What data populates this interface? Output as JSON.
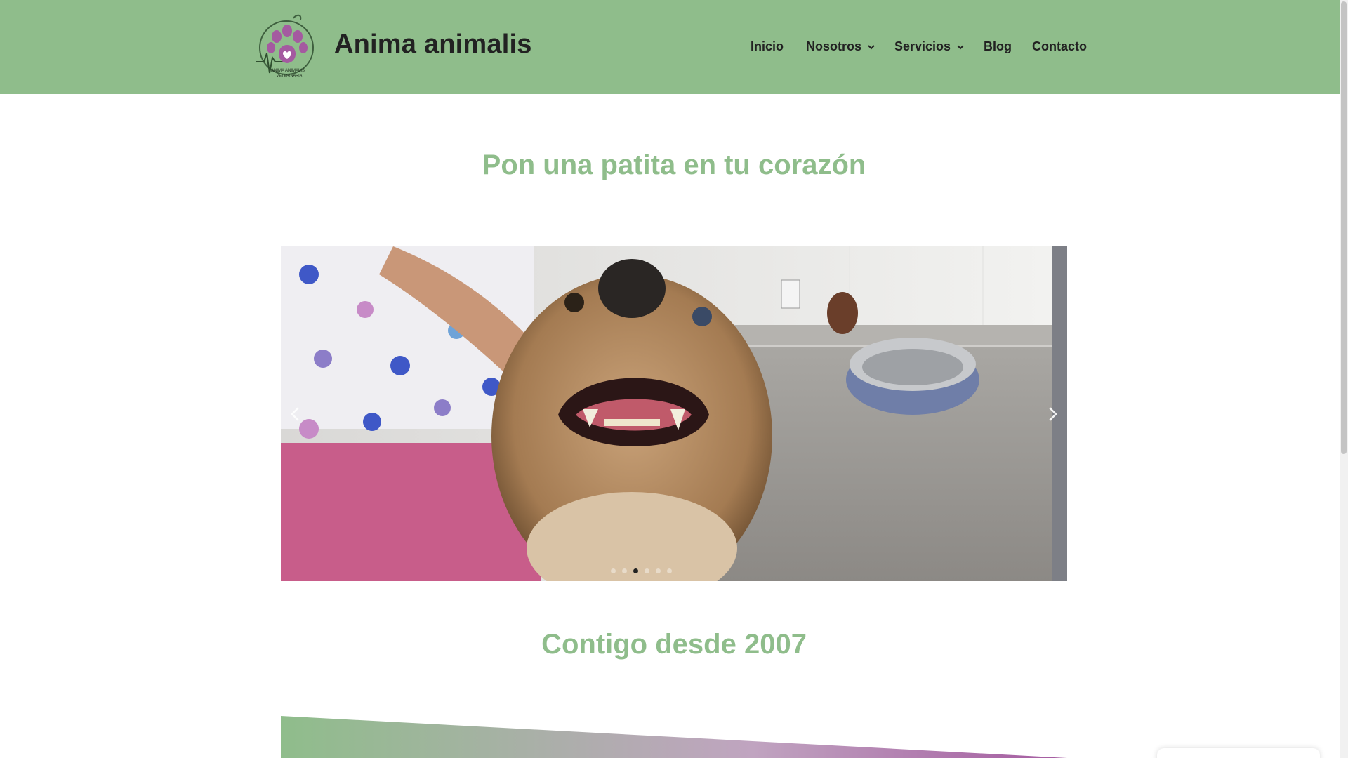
{
  "site": {
    "title": "Anima animalis",
    "logo_text_line1": "ANIMA ANIMALIS",
    "logo_text_line2": "VETERINARIA"
  },
  "nav": {
    "items": [
      {
        "label": "Inicio",
        "has_dropdown": false
      },
      {
        "label": "Nosotros",
        "has_dropdown": true
      },
      {
        "label": "Servicios",
        "has_dropdown": true
      },
      {
        "label": "Blog",
        "has_dropdown": false
      },
      {
        "label": "Contacto",
        "has_dropdown": false
      }
    ]
  },
  "hero": {
    "heading": "Pon una patita en tu corazón"
  },
  "slider": {
    "slide_count": 6,
    "active_slide": 3,
    "prev_icon": "chevron-left-icon",
    "next_icon": "chevron-right-icon"
  },
  "section2": {
    "heading": "Contigo desde 2007"
  },
  "colors": {
    "header_bg": "#8fbd8b",
    "accent_green": "#8fbd8b",
    "logo_purple": "#a45aa0",
    "text_dark": "#222222"
  }
}
